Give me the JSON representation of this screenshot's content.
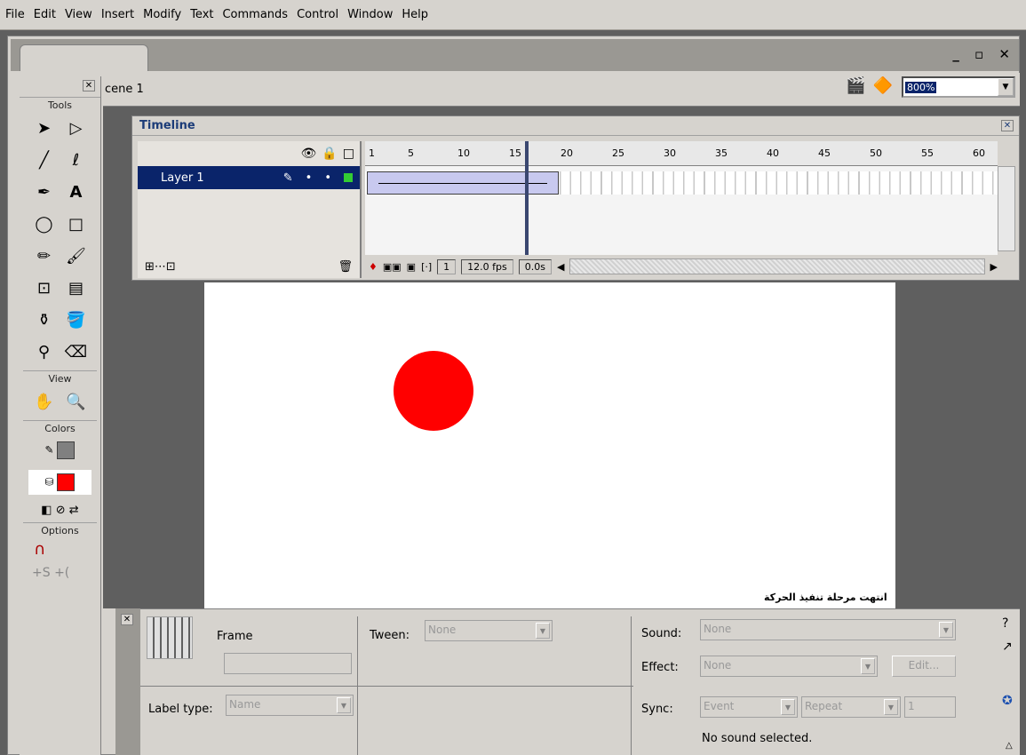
{
  "menu": [
    "File",
    "Edit",
    "View",
    "Insert",
    "Modify",
    "Text",
    "Commands",
    "Control",
    "Window",
    "Help"
  ],
  "window_controls": "_ ▫ ✕",
  "scene": {
    "label": "cene 1",
    "zoom": "800%"
  },
  "toolbox": {
    "sections": {
      "tools": "Tools",
      "view": "View",
      "colors": "Colors",
      "options": "Options"
    },
    "fill_color": "#ff0000",
    "stroke_color": "#808080"
  },
  "timeline": {
    "title": "Timeline",
    "ruler": [
      "1",
      "5",
      "10",
      "15",
      "20",
      "25",
      "30",
      "35",
      "40",
      "45",
      "50",
      "55",
      "60"
    ],
    "layer": "Layer 1",
    "current_frame": "1",
    "fps": "12.0 fps",
    "time": "0.0s"
  },
  "stage": {
    "caption": "انتهت مرحلة تنفيذ الحركة",
    "ball_color": "#ff0000"
  },
  "properties": {
    "frame_label": "Frame",
    "tween_label": "Tween:",
    "tween_value": "None",
    "label_type_label": "Label type:",
    "label_type_value": "Name",
    "sound_label": "Sound:",
    "sound_value": "None",
    "effect_label": "Effect:",
    "effect_value": "None",
    "edit_button": "Edit...",
    "sync_label": "Sync:",
    "sync_value": "Event",
    "repeat_value": "Repeat",
    "repeat_count": "1",
    "sound_status": "No sound selected."
  }
}
